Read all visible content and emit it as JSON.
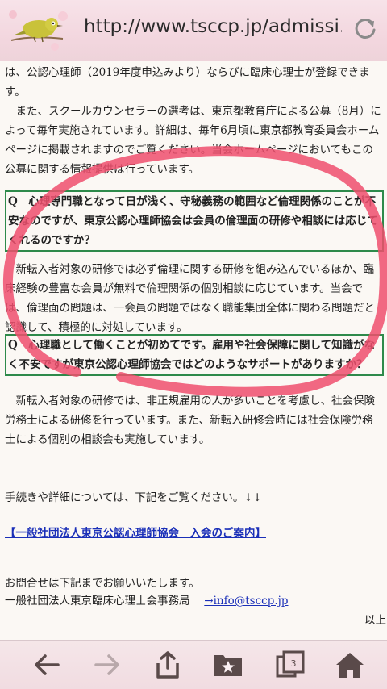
{
  "browser": {
    "url": "http://www.tsccp.jp/admissi…",
    "tab_count": "3"
  },
  "content": {
    "p1": "は、公認心理師（2019年度申込みより）ならびに臨床心理士が登録できます。",
    "p2": "また、スクールカウンセラーの選考は、東京都教育庁による公募（8月）によって毎年実施されています。詳細は、毎年6月頃に東京都教育委員会ホームページに掲載されますのでご覧ください。当会ホームページにおいてもこの公募に関する情報提供は行っています。",
    "q1": "Q　心理専門職となって日が浅く、守秘義務の範囲など倫理関係のことが不安なのですが、東京公認心理師協会は会員の倫理面の研修や相談には応じてくれるのですか？",
    "a1": "新転入者対象の研修では必ず倫理に関する研修を組み込んでいるほか、臨床経験の豊富な会員が無料で倫理関係の個別相談に応じています。当会では、倫理面の問題は、一会員の問題ではなく職能集団全体に関わる問題だと認識して、積極的に対処しています。",
    "q2": "Q　心理職として働くことが初めてです。雇用や社会保障に関して知識がなく不安ですが東京公認心理師協会ではどのようなサポートがありますか？",
    "a2": "新転入者対象の研修では、非正規雇用の人が多いことを考慮し、社会保険労務士による研修を行っています。また、新転入研修会時には社会保険労務士による個別の相談会も実施しています。",
    "procedure": "手続きや詳細については、下記をご覧ください。↓↓",
    "link_label": "【一般社団法人東京公認心理師協会　入会のご案内】",
    "contact_intro": "お問合せは下記までお願いいたします。",
    "contact_org": "一般社団法人東京臨床心理士会事務局",
    "contact_email": "→info@tsccp.jp",
    "end": "以上"
  },
  "colors": {
    "box_border": "#2e8a4b",
    "link": "#1a2fb8",
    "annotation": "#ef4f6d"
  }
}
